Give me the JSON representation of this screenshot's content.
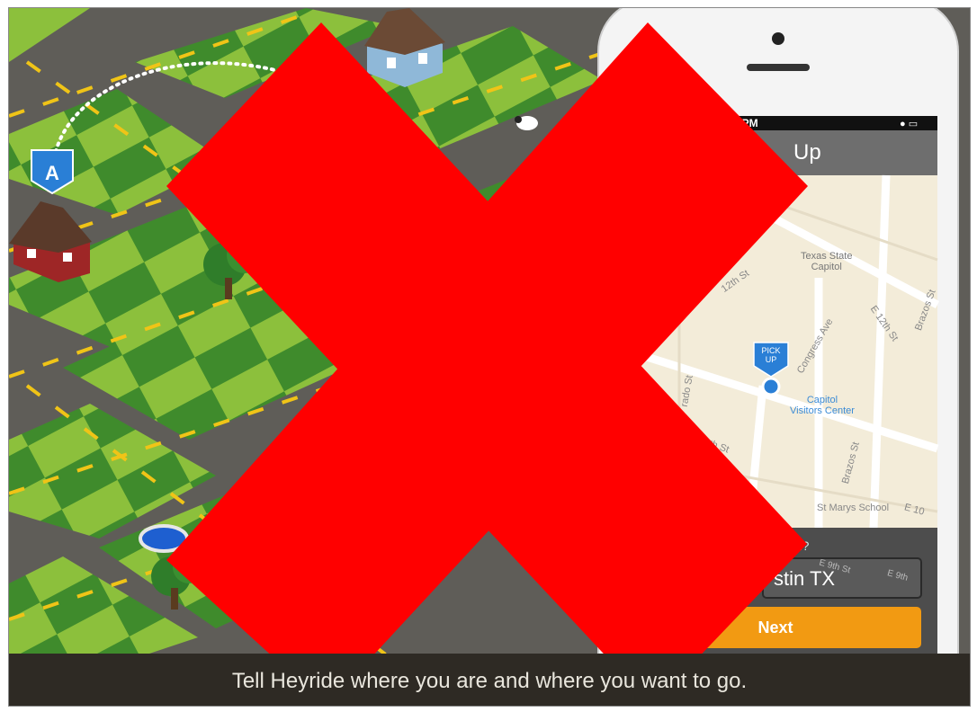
{
  "caption": "Tell Heyride where you are and where you want to go.",
  "marker_a": "A",
  "phone": {
    "status_time": "12 PM",
    "header_title": "Up",
    "question": "m?",
    "address_value": "stin TX",
    "next_button": "Next",
    "pin_label_line1": "PICK",
    "pin_label_line2": "UP",
    "map_labels": {
      "texas_capitol_1": "Texas State",
      "texas_capitol_2": "Capitol",
      "visitors_1": "Capitol",
      "visitors_2": "Visitors Center",
      "congress": "Congress Ave",
      "e12th": "E 12th St",
      "brazos1": "Brazos St",
      "brazos2": "Brazos St",
      "w12th": "12th St",
      "colorado": "rado St",
      "th_st": "th St",
      "st_marys": "St Marys School",
      "e10": "E 10",
      "e9th": "E 9th St",
      "e9th_b": "E 9th"
    }
  },
  "colors": {
    "red_x": "#ff0000",
    "pin_blue": "#2a7fd6",
    "next_orange": "#f29a12",
    "grass_light": "#8cbf3c",
    "grass_dark": "#3e8a2c",
    "road": "#62605b"
  }
}
